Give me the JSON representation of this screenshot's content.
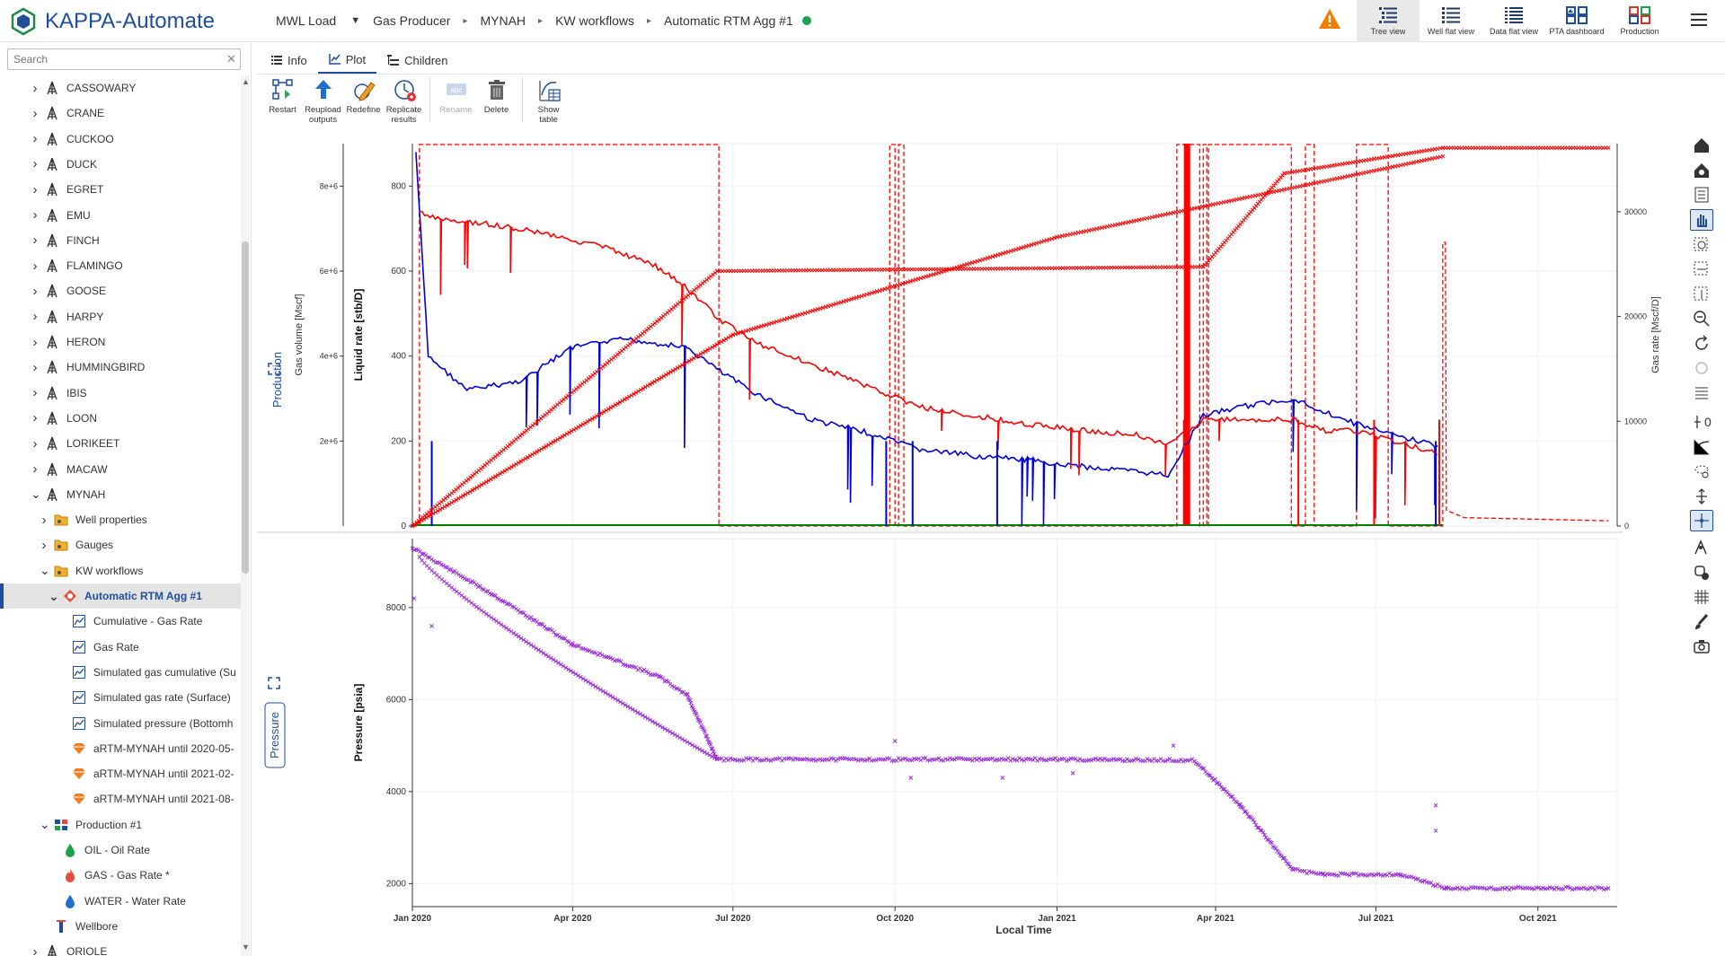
{
  "app": {
    "title": "KAPPA-Automate"
  },
  "breadcrumb": {
    "items": [
      "MWL Load",
      "Gas Producer",
      "MYNAH",
      "KW workflows",
      "Automatic RTM Agg #1"
    ],
    "status_color": "#1aa34a"
  },
  "views": [
    {
      "label": "Tree view",
      "icon": "tree-view-icon",
      "active": true
    },
    {
      "label": "Well flat view",
      "icon": "well-flat-view-icon"
    },
    {
      "label": "Data flat view",
      "icon": "data-flat-view-icon"
    },
    {
      "label": "PTA dashboard",
      "icon": "pta-dashboard-icon"
    },
    {
      "label": "Production",
      "icon": "production-icon"
    }
  ],
  "sidebar": {
    "search_placeholder": "Search",
    "tree": [
      {
        "label": "CASSOWARY",
        "level": 0,
        "type": "well",
        "expanded": false
      },
      {
        "label": "CRANE",
        "level": 0,
        "type": "well",
        "expanded": false
      },
      {
        "label": "CUCKOO",
        "level": 0,
        "type": "well",
        "expanded": false
      },
      {
        "label": "DUCK",
        "level": 0,
        "type": "well",
        "expanded": false
      },
      {
        "label": "EGRET",
        "level": 0,
        "type": "well",
        "expanded": false
      },
      {
        "label": "EMU",
        "level": 0,
        "type": "well",
        "expanded": false
      },
      {
        "label": "FINCH",
        "level": 0,
        "type": "well",
        "expanded": false
      },
      {
        "label": "FLAMINGO",
        "level": 0,
        "type": "well",
        "expanded": false
      },
      {
        "label": "GOOSE",
        "level": 0,
        "type": "well",
        "expanded": false
      },
      {
        "label": "HARPY",
        "level": 0,
        "type": "well",
        "expanded": false
      },
      {
        "label": "HERON",
        "level": 0,
        "type": "well",
        "expanded": false
      },
      {
        "label": "HUMMINGBIRD",
        "level": 0,
        "type": "well",
        "expanded": false
      },
      {
        "label": "IBIS",
        "level": 0,
        "type": "well",
        "expanded": false
      },
      {
        "label": "LOON",
        "level": 0,
        "type": "well",
        "expanded": false
      },
      {
        "label": "LORIKEET",
        "level": 0,
        "type": "well",
        "expanded": false
      },
      {
        "label": "MACAW",
        "level": 0,
        "type": "well",
        "expanded": false
      },
      {
        "label": "MYNAH",
        "level": 0,
        "type": "well",
        "expanded": true
      },
      {
        "label": "Well properties",
        "level": 1,
        "type": "folder",
        "expanded": false
      },
      {
        "label": "Gauges",
        "level": 1,
        "type": "folder",
        "expanded": false
      },
      {
        "label": "KW workflows",
        "level": 1,
        "type": "folder",
        "expanded": true
      },
      {
        "label": "Automatic RTM Agg #1",
        "level": 2,
        "type": "workflow",
        "expanded": true,
        "selected": true
      },
      {
        "label": "Cumulative - Gas Rate",
        "level": 3,
        "type": "series"
      },
      {
        "label": "Gas Rate",
        "level": 3,
        "type": "series"
      },
      {
        "label": "Simulated gas cumulative (Su",
        "level": 3,
        "type": "series"
      },
      {
        "label": "Simulated gas rate (Surface)",
        "level": 3,
        "type": "series"
      },
      {
        "label": "Simulated pressure (Bottomh",
        "level": 3,
        "type": "series"
      },
      {
        "label": "aRTM-MYNAH until 2020-05-",
        "level": 3,
        "type": "model"
      },
      {
        "label": "aRTM-MYNAH until 2021-02-",
        "level": 3,
        "type": "model"
      },
      {
        "label": "aRTM-MYNAH until 2021-08-",
        "level": 3,
        "type": "model"
      },
      {
        "label": "Production #1",
        "level": 1,
        "type": "production",
        "expanded": true
      },
      {
        "label": "OIL - Oil Rate",
        "level": 2,
        "type": "oil"
      },
      {
        "label": "GAS - Gas Rate *",
        "level": 2,
        "type": "gas"
      },
      {
        "label": "WATER - Water Rate",
        "level": 2,
        "type": "water"
      },
      {
        "label": "Wellbore",
        "level": 1,
        "type": "wellbore"
      },
      {
        "label": "ORIOLE",
        "level": 0,
        "type": "well",
        "expanded": false
      }
    ]
  },
  "tabs": [
    {
      "label": "Info",
      "icon": "info-list-icon"
    },
    {
      "label": "Plot",
      "icon": "plot-icon",
      "active": true
    },
    {
      "label": "Children",
      "icon": "children-icon"
    }
  ],
  "toolbar": [
    {
      "label": "Restart",
      "icon": "restart-icon"
    },
    {
      "label": "Reupload outputs",
      "icon": "upload-arrow-icon"
    },
    {
      "label": "Redefine",
      "icon": "redefine-pencil-icon"
    },
    {
      "label": "Replicate results",
      "icon": "replicate-clock-icon"
    },
    {
      "label": "Rename",
      "icon": "rename-icon",
      "disabled": true
    },
    {
      "label": "Delete",
      "icon": "trash-icon"
    },
    {
      "label": "Show table",
      "icon": "show-table-icon"
    }
  ],
  "plot": {
    "side_labels": {
      "top": "Production",
      "bottom": "Pressure"
    },
    "right_tools": [
      "home-icon",
      "settings-home-icon",
      "list-icon",
      "pan-hand-icon",
      "zoom-box-icon",
      "zoom-x-icon",
      "zoom-y-icon",
      "zoom-out-icon",
      "rotate-icon",
      "refresh-disabled-icon",
      "legend-icon",
      "y-offset-icon",
      "curve-icon",
      "lasso-icon",
      "vertical-arrows-icon",
      "crosshair-icon",
      "marker-icon",
      "point-icon",
      "grid-icon",
      "brush-icon",
      "camera-icon"
    ],
    "y_offset_value": "0"
  },
  "chart_data": [
    {
      "type": "line",
      "title": "",
      "xlabel": "Local Time",
      "x_ticks": [
        "Jan 2020",
        "Apr 2020",
        "Jul 2020",
        "Oct 2020",
        "Jan 2021",
        "Apr 2021",
        "Jul 2021",
        "Oct 2021"
      ],
      "xlim": [
        "2020-01-01",
        "2021-11-15"
      ],
      "axes": [
        {
          "label": "Gas volume [Mscf]",
          "ticks": [
            "2e+6",
            "4e+6",
            "6e+6",
            "8e+6"
          ],
          "lim": [
            0,
            9000000
          ]
        },
        {
          "label": "Liquid rate [stb/D]",
          "ticks": [
            0,
            200,
            400,
            600,
            800
          ],
          "lim": [
            0,
            900
          ]
        },
        {
          "label": "Gas rate [Mscf/D]",
          "ticks": [
            0,
            10000,
            20000,
            30000
          ],
          "lim": [
            0,
            36500
          ],
          "side": "right"
        }
      ],
      "series": [
        {
          "axis": "Liquid rate [stb/D]",
          "color": "#ff0000",
          "x": [
            "2020-01-05",
            "2020-01-20",
            "2020-02-15",
            "2020-03-15",
            "2020-04-15",
            "2020-05-15",
            "2020-06-05",
            "2020-06-25",
            "2020-07-15",
            "2020-08-15",
            "2020-09-15",
            "2020-10-15",
            "2020-11-15",
            "2020-12-15",
            "2021-01-15",
            "2021-02-15",
            "2021-03-05",
            "2021-03-25",
            "2021-04-15",
            "2021-05-15",
            "2021-06-01",
            "2021-06-20",
            "2021-07-10",
            "2021-07-25",
            "2021-08-05"
          ],
          "values": [
            740,
            720,
            710,
            690,
            660,
            620,
            560,
            480,
            430,
            380,
            330,
            280,
            260,
            240,
            225,
            215,
            190,
            250,
            250,
            250,
            225,
            225,
            200,
            185,
            170
          ]
        },
        {
          "axis": "Liquid rate [stb/D]",
          "color": "#0000dd",
          "x": [
            "2020-01-03",
            "2020-01-10",
            "2020-02-01",
            "2020-03-01",
            "2020-04-01",
            "2020-05-01",
            "2020-06-05",
            "2020-06-25",
            "2020-07-15",
            "2020-08-15",
            "2020-09-15",
            "2020-10-15",
            "2020-11-15",
            "2020-12-15",
            "2021-01-15",
            "2021-02-15",
            "2021-03-05",
            "2021-03-25",
            "2021-04-15",
            "2021-05-15",
            "2021-06-01",
            "2021-06-20",
            "2021-07-10",
            "2021-07-25",
            "2021-08-05"
          ],
          "values": [
            880,
            400,
            320,
            340,
            420,
            440,
            420,
            360,
            310,
            250,
            220,
            180,
            165,
            155,
            140,
            128,
            120,
            260,
            280,
            300,
            270,
            240,
            215,
            200,
            190
          ]
        },
        {
          "axis": "Gas volume [Mscf]",
          "color": "#ff0000",
          "marker": "x",
          "x": [
            "2020-01-01",
            "2020-06-22",
            "2021-03-25",
            "2021-05-10",
            "2021-08-08",
            "2021-11-10"
          ],
          "values": [
            0,
            6000000,
            6100000,
            8300000,
            8900000,
            8900000
          ]
        },
        {
          "axis": "Gas volume [Mscf]",
          "color": "#ff0000",
          "marker": "x",
          "x": [
            "2020-01-01",
            "2020-07-01",
            "2021-01-01",
            "2021-08-08"
          ],
          "values": [
            0,
            4500000,
            6800000,
            8700000
          ]
        },
        {
          "axis": "Gas rate [Mscf/D]",
          "color": "#ff0000",
          "dashed": true,
          "x": [
            "2020-06-22",
            "2021-08-10",
            "2021-11-10"
          ],
          "values": [
            0,
            800,
            500
          ]
        },
        {
          "axis": "Liquid rate [stb/D]",
          "color": "#008000",
          "x": [
            "2020-01-01",
            "2021-08-08"
          ],
          "values": [
            0,
            0
          ]
        }
      ]
    },
    {
      "type": "scatter",
      "xlabel": "Local Time",
      "ylabel": "Pressure [psia]",
      "y_ticks": [
        2000,
        4000,
        6000,
        8000
      ],
      "ylim": [
        1500,
        9500
      ],
      "series": [
        {
          "name": "",
          "color": "#9b30d9",
          "x": [
            "2020-01-01",
            "2020-02-15",
            "2020-04-01",
            "2020-05-20",
            "2020-06-05",
            "2020-06-22",
            "2020-12-31",
            "2021-03-20",
            "2021-04-15",
            "2021-05-15",
            "2021-06-01",
            "2021-07-15",
            "2021-08-10",
            "2021-11-10"
          ],
          "values": [
            9300,
            8300,
            7200,
            6500,
            6100,
            4700,
            4700,
            4680,
            3700,
            2300,
            2200,
            2200,
            1900,
            1900
          ]
        }
      ]
    }
  ]
}
